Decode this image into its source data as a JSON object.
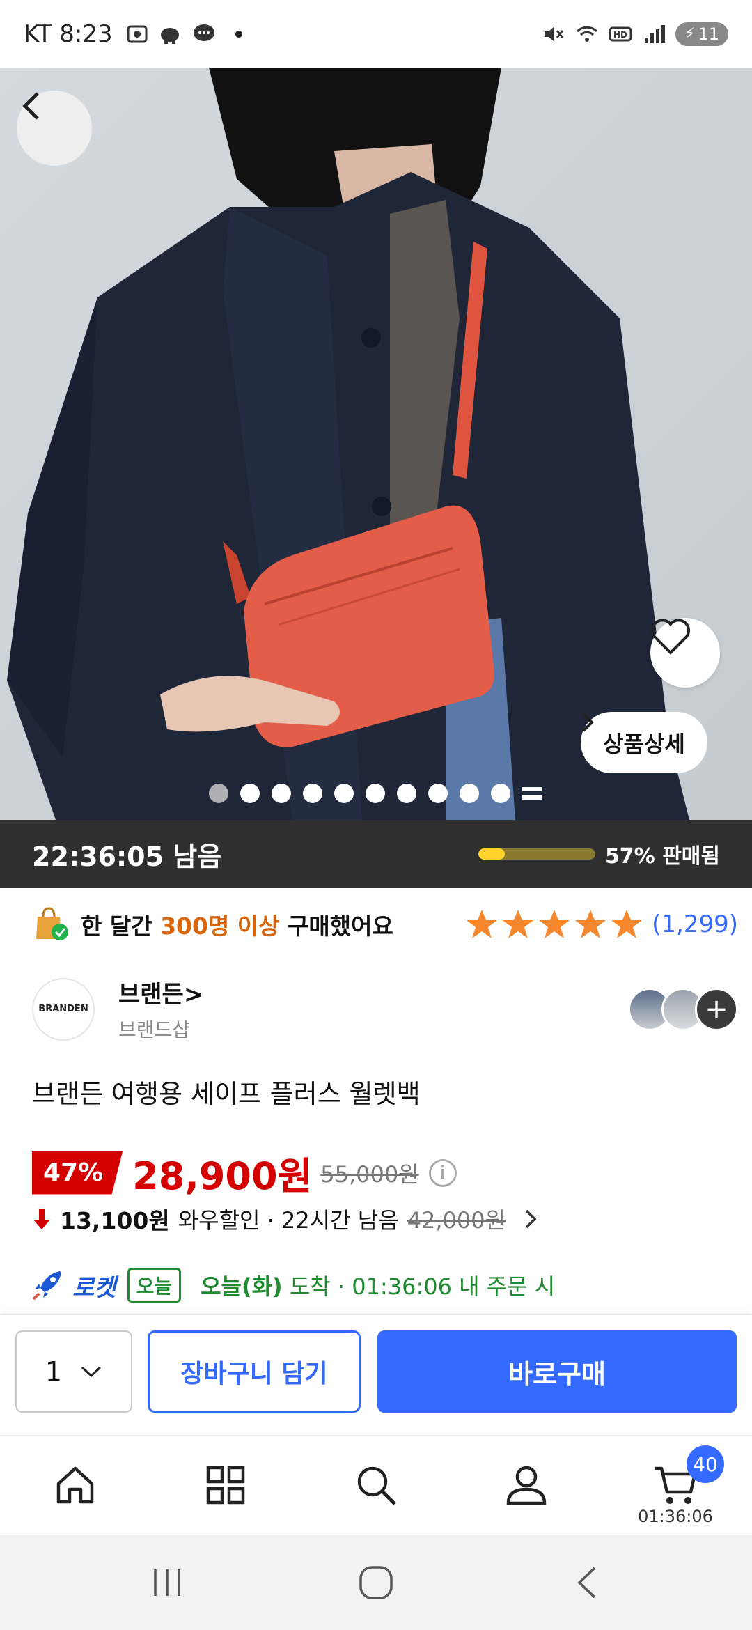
{
  "status_bar": {
    "carrier_time": "KT 8:23",
    "battery": "11"
  },
  "product_image": {
    "page_count": 11,
    "active_index": 0
  },
  "buttons": {
    "detail_label": "상품상세"
  },
  "deal": {
    "time_left": "22:36:05 남음",
    "sold_percent": 57,
    "sold_label": "57% 판매됨"
  },
  "social_proof": {
    "prefix": "한 달간 ",
    "highlight": "300명 이상",
    "suffix": " 구매했어요"
  },
  "rating": {
    "stars": 5,
    "count": "(1,299)"
  },
  "brand": {
    "logo_text": "BRANDEN",
    "name": "브랜든>",
    "shop": "브랜드샵"
  },
  "product": {
    "title": "브랜든 여행용 세이프 플러스 월렛백"
  },
  "price": {
    "discount": "47%",
    "sale": "28,900원",
    "original": "55,000원"
  },
  "wow": {
    "amount": "13,100원",
    "text": "와우할인 · 22시간 남음",
    "original": "42,000원"
  },
  "delivery": {
    "rocket": "로켓",
    "badge": "오늘",
    "day": "오늘(화)",
    "arrive": " 도착 · ",
    "order_time": "01:36:06 내 주문 시"
  },
  "purchase": {
    "quantity": "1",
    "cart_label": "장바구니 담기",
    "buy_label": "바로구매"
  },
  "nav": {
    "cart_badge": "40",
    "cart_timer": "01:36:06"
  },
  "colors": {
    "accent": "#346aff",
    "sale_red": "#d40000",
    "delivery_green": "#1f8a2f",
    "highlight_orange": "#d9640a"
  }
}
